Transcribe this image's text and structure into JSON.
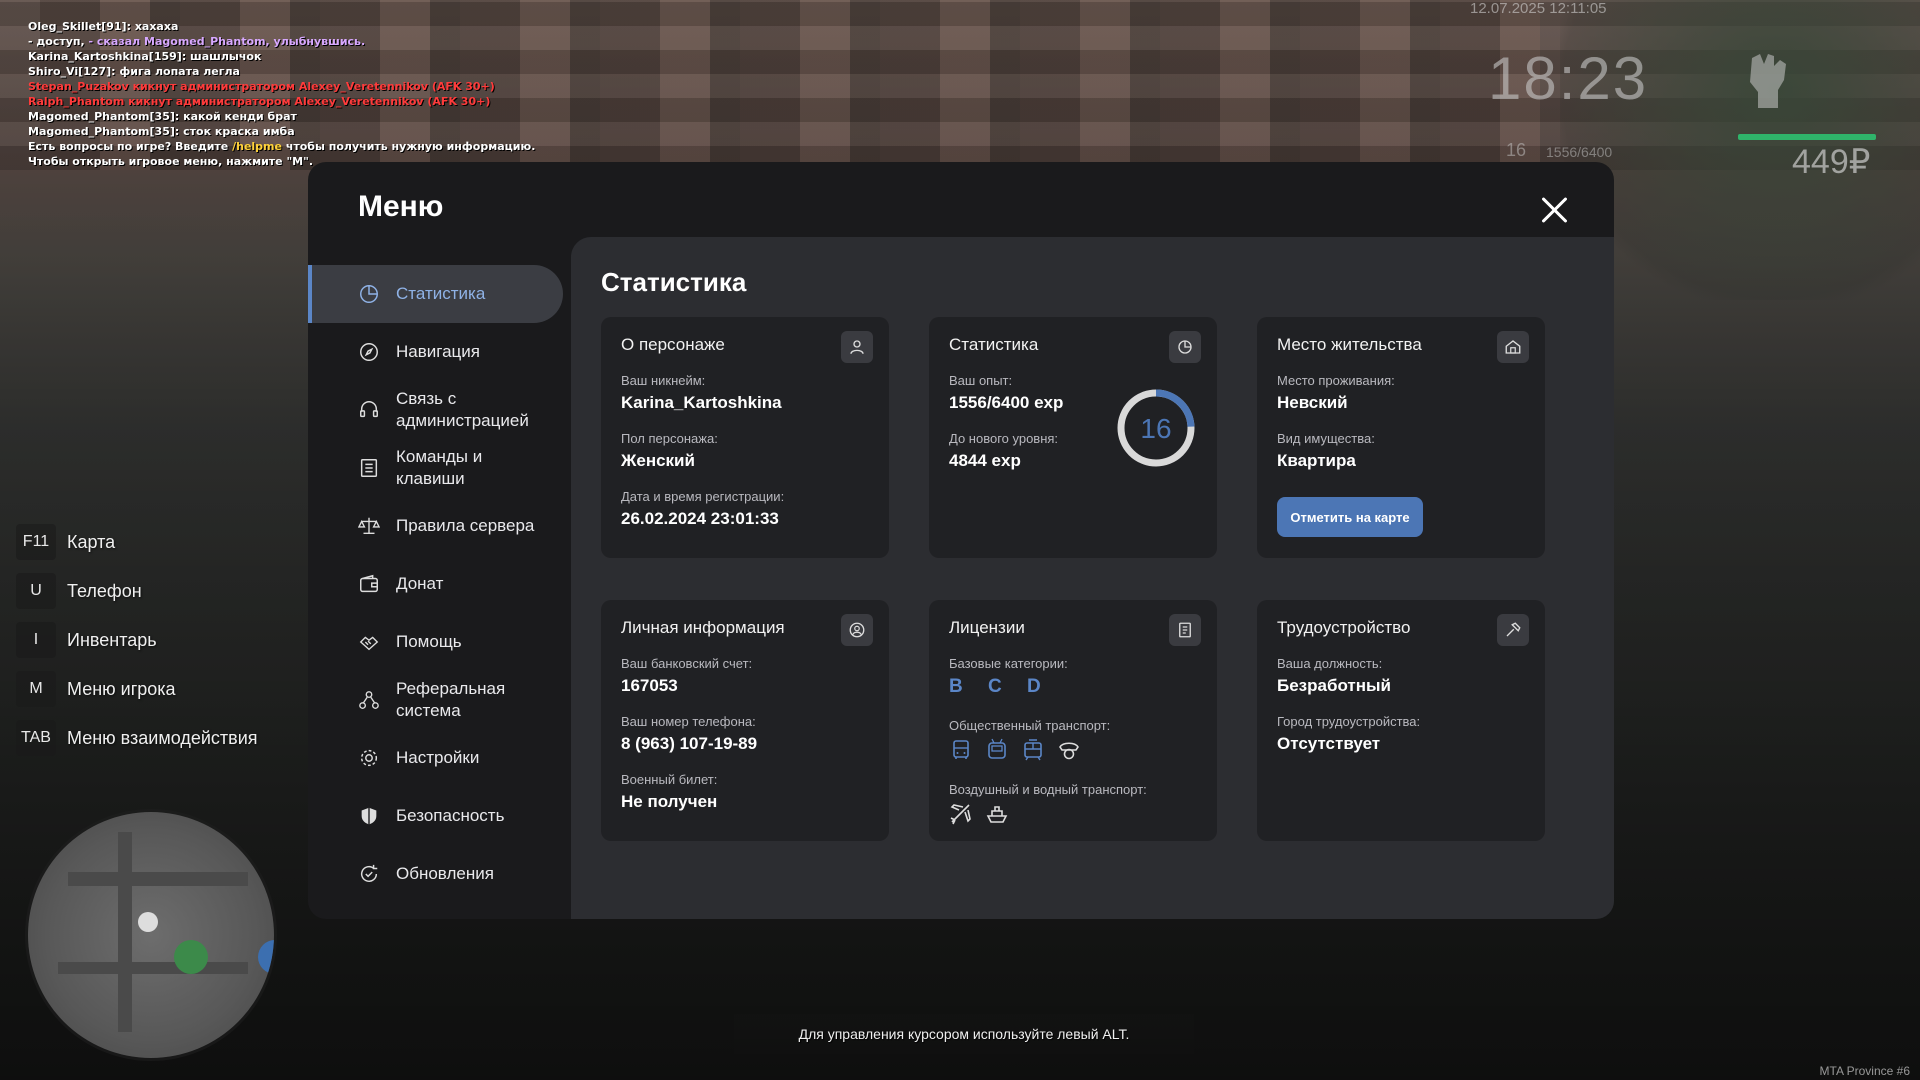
{
  "chat": [
    {
      "parts": [
        {
          "t": "Oleg_Skillet[91]: хахаха",
          "c": "white"
        }
      ]
    },
    {
      "parts": [
        {
          "t": "- доступ, ",
          "c": "white"
        },
        {
          "t": "- сказал Magomed_Phantom, улыбнувшись.",
          "c": "purple"
        }
      ]
    },
    {
      "parts": [
        {
          "t": "Karina_Kartoshkina[159]: шашлычок",
          "c": "white"
        }
      ]
    },
    {
      "parts": [
        {
          "t": "Shiro_Vi[127]: фига лопата легла",
          "c": "white"
        }
      ]
    },
    {
      "parts": [
        {
          "t": "Stepan_Puzakov кикнут администратором Alexey_Veretennikov (AFK 30+)",
          "c": "red"
        }
      ]
    },
    {
      "parts": [
        {
          "t": "Ralph_Phantom кикнут администратором Alexey_Veretennikov (AFK 30+)",
          "c": "red"
        }
      ]
    },
    {
      "parts": [
        {
          "t": "Magomed_Phantom[35]: какой кенди брат",
          "c": "white"
        }
      ]
    },
    {
      "parts": [
        {
          "t": "Magomed_Phantom[35]: сток краска имба",
          "c": "white"
        }
      ]
    },
    {
      "parts": [
        {
          "t": "Есть вопросы по игре? Введите ",
          "c": "white"
        },
        {
          "t": "/helpme",
          "c": "yellow"
        },
        {
          "t": " чтобы получить нужную информацию.",
          "c": "white"
        }
      ]
    },
    {
      "parts": [
        {
          "t": "Чтобы открыть игровое меню, нажмите \"M\".",
          "c": "white"
        }
      ]
    }
  ],
  "hud": {
    "date": "12.07.2025 12:11:05",
    "time": "18:23",
    "level": "16",
    "exp": "1556/6400",
    "money": "449₽",
    "health_fraction": 1.0
  },
  "hotkeys": [
    {
      "key": "F11",
      "label": "Карта"
    },
    {
      "key": "U",
      "label": "Телефон"
    },
    {
      "key": "I",
      "label": "Инвентарь"
    },
    {
      "key": "M",
      "label": "Меню игрока"
    },
    {
      "key": "TAB",
      "label": "Меню взаимодействия"
    }
  ],
  "menu": {
    "title": "Меню",
    "nav": [
      {
        "label": "Статистика",
        "icon": "chart-icon",
        "active": true
      },
      {
        "label": "Навигация",
        "icon": "compass-icon"
      },
      {
        "label": "Связь с администрацией",
        "icon": "headset-icon"
      },
      {
        "label": "Команды и клавиши",
        "icon": "list-icon"
      },
      {
        "label": "Правила сервера",
        "icon": "scales-icon"
      },
      {
        "label": "Донат",
        "icon": "wallet-icon"
      },
      {
        "label": "Помощь",
        "icon": "handshake-icon"
      },
      {
        "label": "Реферальная система",
        "icon": "referral-icon"
      },
      {
        "label": "Настройки",
        "icon": "gear-icon"
      },
      {
        "label": "Безопасность",
        "icon": "shield-icon"
      },
      {
        "label": "Обновления",
        "icon": "update-icon"
      }
    ]
  },
  "stats": {
    "title": "Статистика",
    "character": {
      "title": "О персонаже",
      "nick_label": "Ваш никнейм:",
      "nick": "Karina_Kartoshkina",
      "gender_label": "Пол персонажа:",
      "gender": "Женский",
      "reg_label": "Дата и время регистрации:",
      "reg": "26.02.2024 23:01:33"
    },
    "statistics": {
      "title": "Статистика",
      "exp_label": "Ваш опыт:",
      "exp": "1556/6400 exp",
      "next_label": "До нового уровня:",
      "next": "4844 exp",
      "level": "16",
      "progress": 0.243
    },
    "residence": {
      "title": "Место жительства",
      "place_label": "Место проживания:",
      "place": "Невский",
      "type_label": "Вид имущества:",
      "type": "Квартира",
      "button": "Отметить на карте"
    },
    "personal": {
      "title": "Личная информация",
      "bank_label": "Ваш банковский счет:",
      "bank": "167053",
      "phone_label": "Ваш номер телефона:",
      "phone": "8 (963) 107-19-89",
      "military_label": "Военный билет:",
      "military": "Не получен"
    },
    "licenses": {
      "title": "Лицензии",
      "base_label": "Базовые категории:",
      "categories": "B C D",
      "public_label": "Общественный транспорт:",
      "air_label": "Воздушный и водный транспорт:"
    },
    "job": {
      "title": "Трудоустройство",
      "position_label": "Ваша должность:",
      "position": "Безработный",
      "city_label": "Город трудоустройства:",
      "city": "Отсутствует"
    }
  },
  "hint": "Для управления курсором используйте левый ALT.",
  "server": "MTA Province #6"
}
